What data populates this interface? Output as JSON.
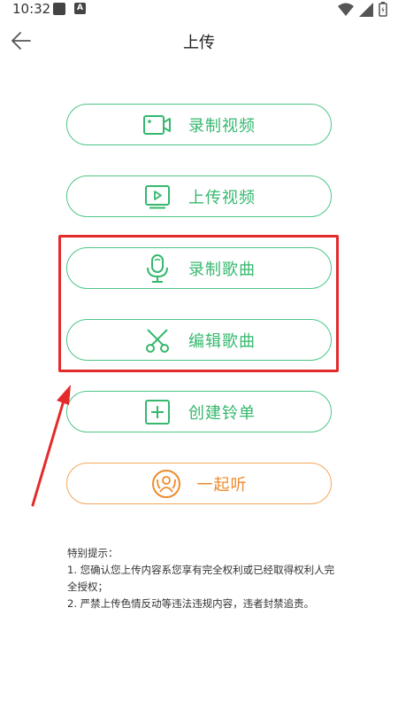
{
  "status_bar": {
    "time": "10:32",
    "notif_badge": "A"
  },
  "header": {
    "title": "上传"
  },
  "actions": [
    {
      "label": "录制视频",
      "icon": "video-camera-icon"
    },
    {
      "label": "上传视频",
      "icon": "video-upload-icon"
    },
    {
      "label": "录制歌曲",
      "icon": "microphone-icon"
    },
    {
      "label": "编辑歌曲",
      "icon": "scissors-icon"
    },
    {
      "label": "创建铃单",
      "icon": "add-square-icon"
    },
    {
      "label": "一起听",
      "icon": "listen-together-icon"
    }
  ],
  "notice": {
    "title": "特别提示：",
    "line1": "1. 您确认您上传内容系您享有完全权利或已经取得权利人完全授权；",
    "line2": "2. 严禁上传色情反动等违法违规内容，违者封禁追责。"
  },
  "colors": {
    "green": "#35b86e",
    "orange": "#ee8b2c",
    "highlight_red": "#e32b2b"
  }
}
